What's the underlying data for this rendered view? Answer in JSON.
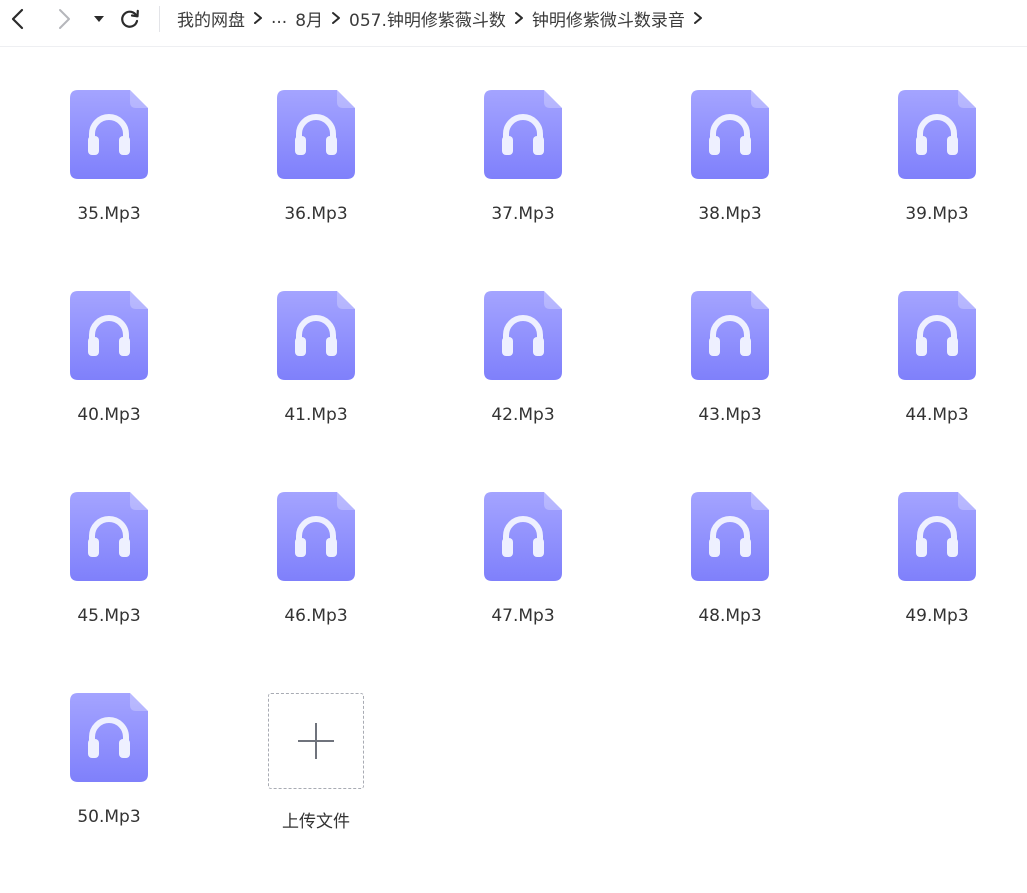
{
  "toolbar": {
    "back_icon": "chevron-left-icon",
    "forward_icon": "chevron-right-icon",
    "dropdown_icon": "caret-down-icon",
    "refresh_icon": "refresh-icon"
  },
  "breadcrumb": {
    "items": [
      "我的网盘",
      "...",
      "8月",
      "057.钟明修紫薇斗数",
      "钟明修紫微斗数录音"
    ],
    "separator_icon": "chevron-right-icon"
  },
  "files": [
    {
      "name": "35.Mp3",
      "icon": "audio-file-icon"
    },
    {
      "name": "36.Mp3",
      "icon": "audio-file-icon"
    },
    {
      "name": "37.Mp3",
      "icon": "audio-file-icon"
    },
    {
      "name": "38.Mp3",
      "icon": "audio-file-icon"
    },
    {
      "name": "39.Mp3",
      "icon": "audio-file-icon"
    },
    {
      "name": "40.Mp3",
      "icon": "audio-file-icon"
    },
    {
      "name": "41.Mp3",
      "icon": "audio-file-icon"
    },
    {
      "name": "42.Mp3",
      "icon": "audio-file-icon"
    },
    {
      "name": "43.Mp3",
      "icon": "audio-file-icon"
    },
    {
      "name": "44.Mp3",
      "icon": "audio-file-icon"
    },
    {
      "name": "45.Mp3",
      "icon": "audio-file-icon"
    },
    {
      "name": "46.Mp3",
      "icon": "audio-file-icon"
    },
    {
      "name": "47.Mp3",
      "icon": "audio-file-icon"
    },
    {
      "name": "48.Mp3",
      "icon": "audio-file-icon"
    },
    {
      "name": "49.Mp3",
      "icon": "audio-file-icon"
    },
    {
      "name": "50.Mp3",
      "icon": "audio-file-icon"
    }
  ],
  "upload": {
    "label": "上传文件",
    "icon": "plus-icon"
  },
  "colors": {
    "file_icon_top": "#a4a4ff",
    "file_icon_bottom": "#7f80fb",
    "headphone": "#eef0ff",
    "text": "#333333"
  }
}
